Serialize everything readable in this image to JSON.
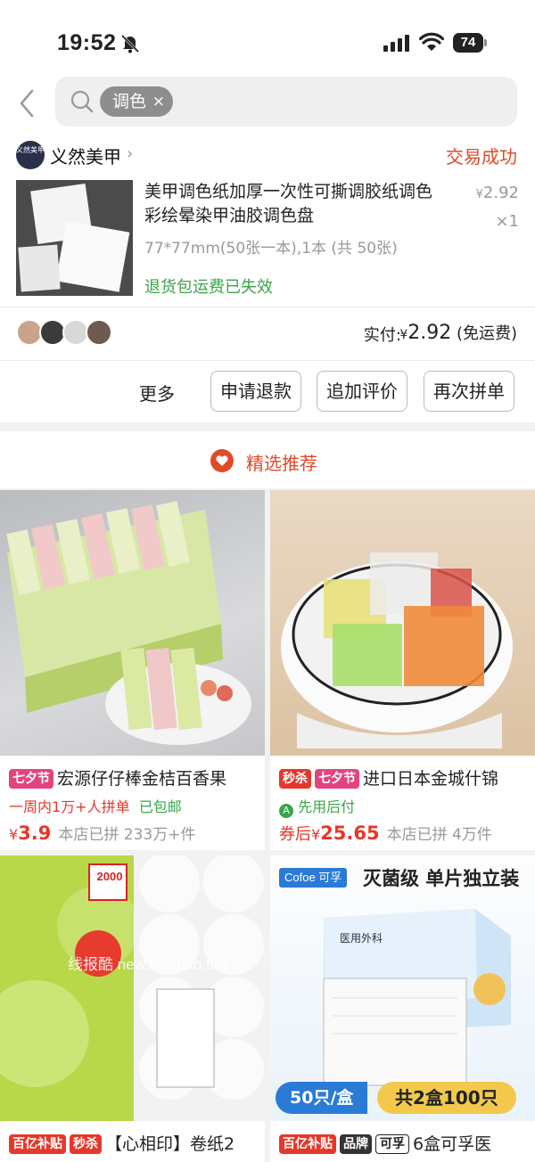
{
  "status": {
    "time": "19:52",
    "battery": "74"
  },
  "search": {
    "chip": "调色",
    "chip_close": "×"
  },
  "order": {
    "shop_logo_text": "义然美甲",
    "shop_name": "义然美甲",
    "status": "交易成功",
    "product_title": "美甲调色纸加厚一次性可撕调胶纸调色彩绘晕染甲油胶调色盘",
    "price_symbol": "¥",
    "price": "2.92",
    "qty": "×1",
    "spec": "77*77mm(50张一本),1本 (共 50张)",
    "notice": "退货包运费已失效",
    "pay_label": "实付:",
    "pay_symbol": "¥",
    "pay_amount": "2.92",
    "pay_note": "(免运费)",
    "actions": {
      "more": "更多",
      "refund": "申请退款",
      "review": "追加评价",
      "rebuy": "再次拼单"
    }
  },
  "recommend": {
    "title": "精选推荐",
    "items": [
      {
        "tags": [
          "七夕节"
        ],
        "title": "宏源仔仔棒金桔百香果",
        "sub1": "一周内1万+人拼单",
        "sub2": "已包邮",
        "price_prefix": "",
        "price_symbol": "¥",
        "price": "3.9",
        "meta": "本店已拼 233万+件"
      },
      {
        "tags": [
          "秒杀",
          "七夕节"
        ],
        "title": "进口日本金城什锦",
        "sub1": "先用后付",
        "sub2": "",
        "price_prefix": "券后",
        "price_symbol": "¥",
        "price": "25.65",
        "meta": "本店已拼 4万件"
      },
      {
        "tags": [
          "百亿补贴",
          "秒杀"
        ],
        "title": "【心相印】卷纸2",
        "img_label": "2000"
      },
      {
        "tags": [
          "百亿补贴",
          "品牌",
          "可孚"
        ],
        "title": "6盒可孚医",
        "img_top": "灭菌级 单片独立装",
        "img_brand": "Cofoe 可孚",
        "img_left_badge": "50只/盒",
        "img_right_badge": "共2盒100只",
        "box_label": "医用外科"
      }
    ]
  },
  "watermark": "线报酷 new.xianbao.fun",
  "colors": {
    "accent": "#e04a28",
    "green": "#3aa54a",
    "pink_tag": "#e3447f",
    "red_tag": "#e5382b"
  }
}
